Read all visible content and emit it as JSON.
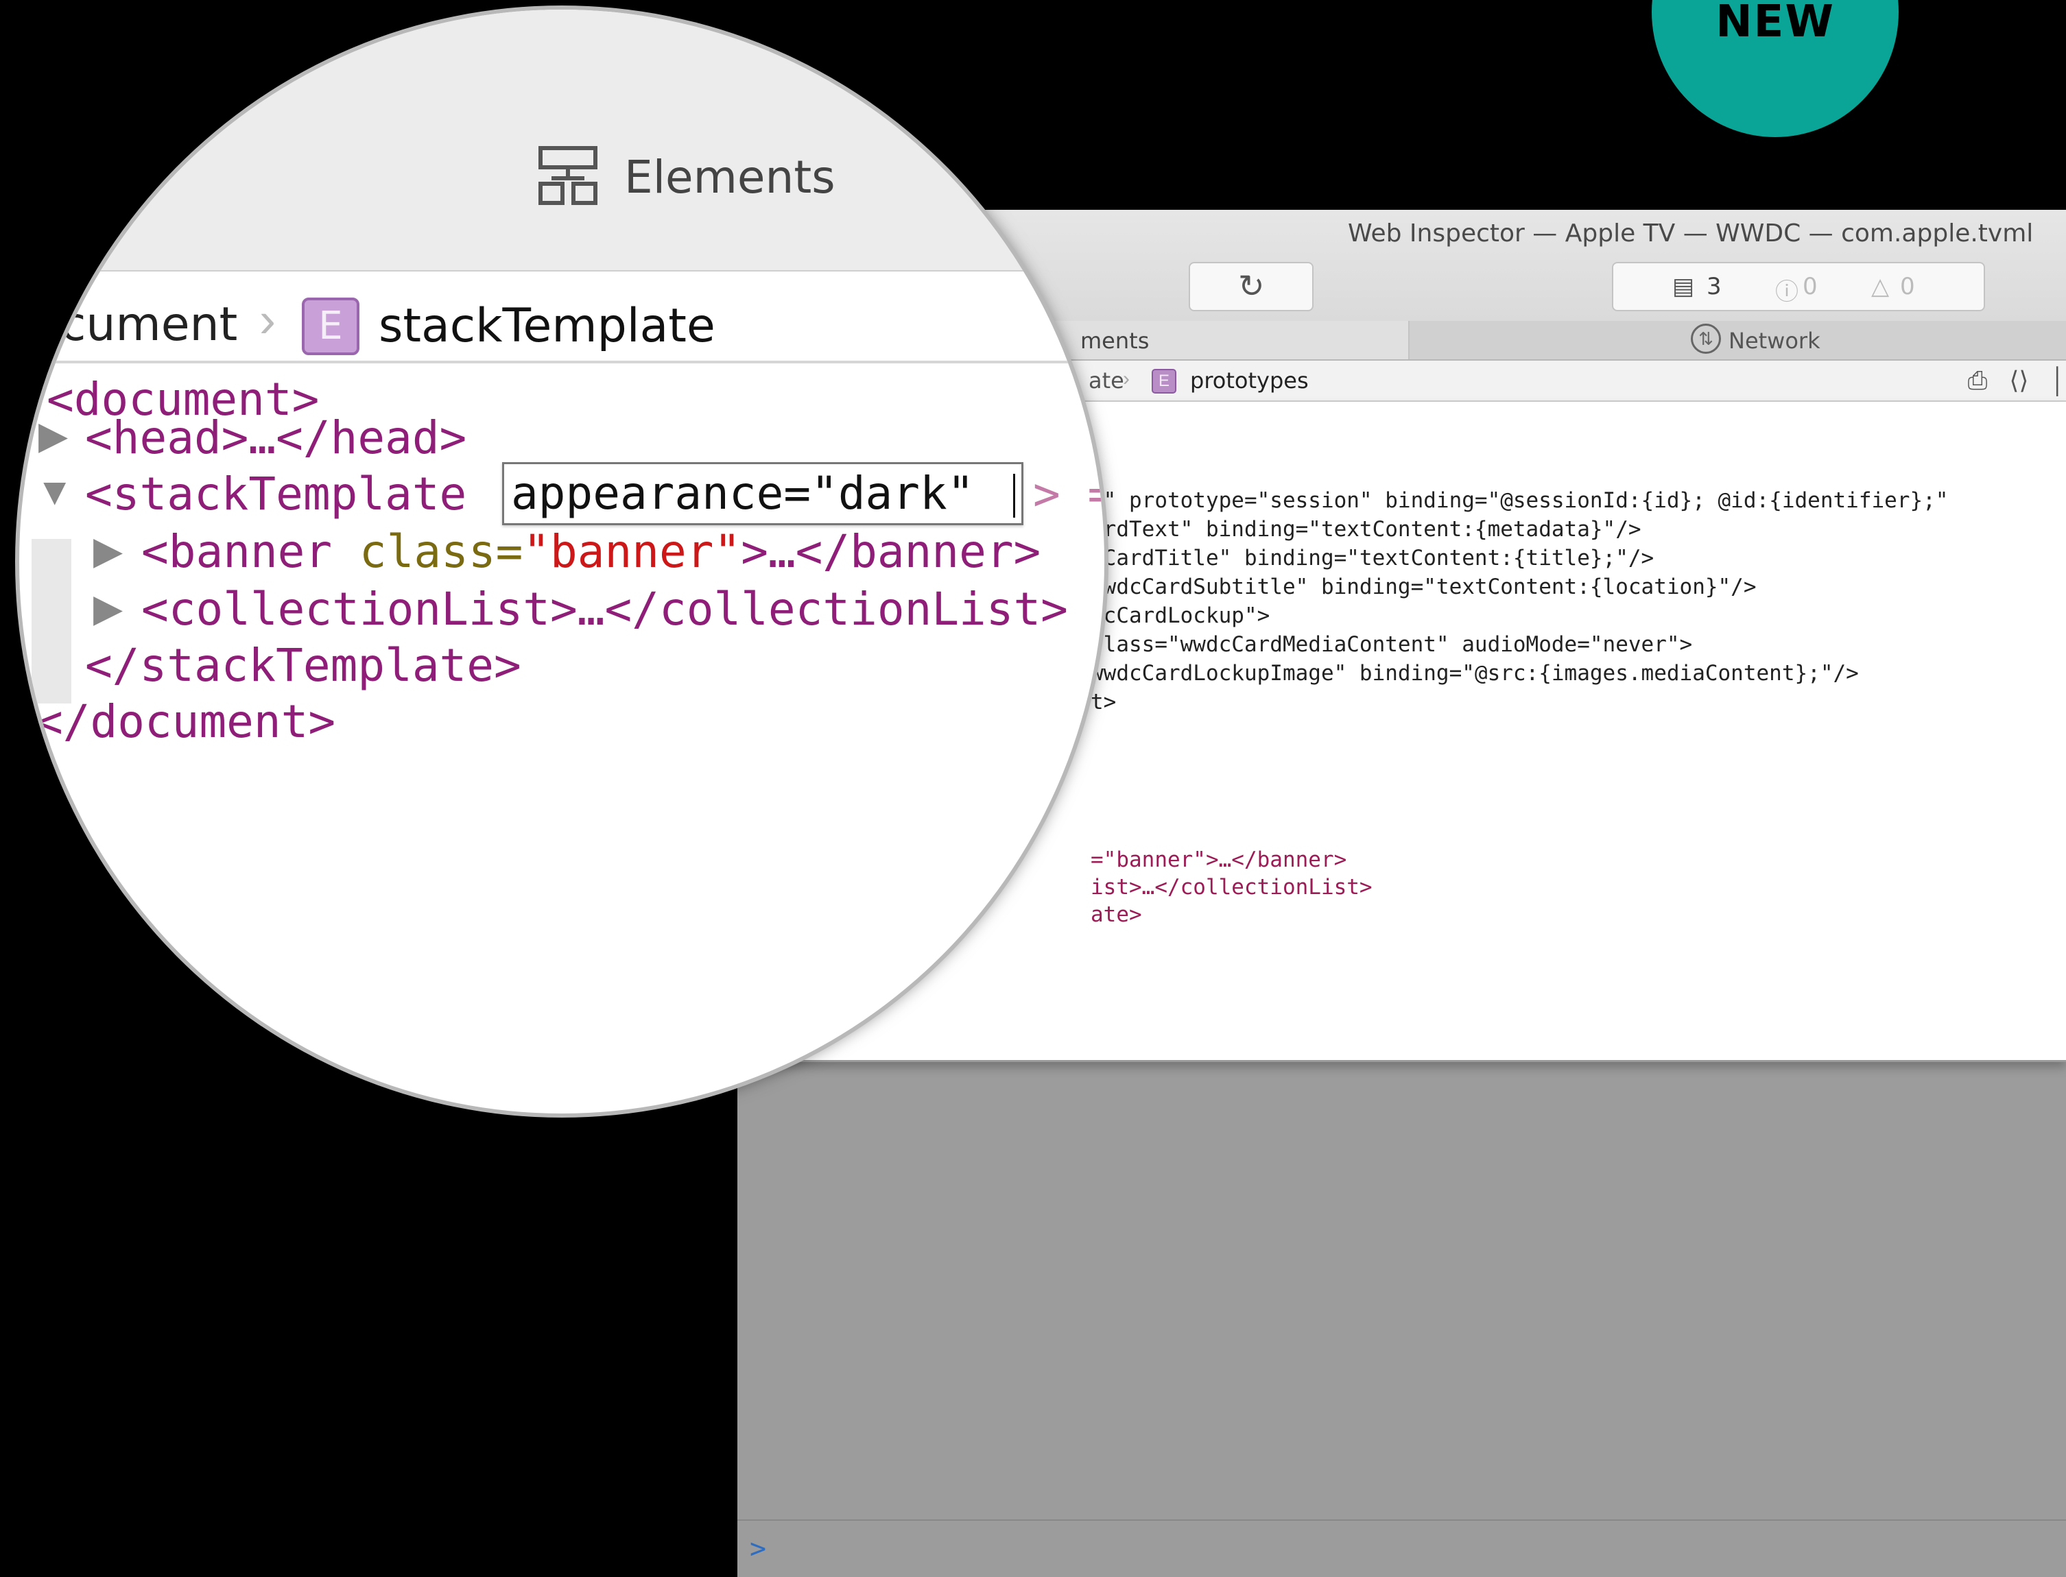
{
  "badge": {
    "label": "NEW",
    "color": "#0aa596"
  },
  "window": {
    "title": "Web Inspector — Apple TV — WWDC — com.apple.tvml",
    "toolbar": {
      "reload_icon": "reload-icon",
      "messages_count": "3",
      "errors_count": "0",
      "warnings_count": "0"
    },
    "tabs": {
      "elements_partial": "ments",
      "network": "Network"
    },
    "pathbar": {
      "truncated_item": "ate",
      "item": "prototypes"
    },
    "code_top": [
      "d\" prototype=\"session\" binding=\"@sessionId:{id}; @id:{identifier};\"",
      "ardText\" binding=\"textContent:{metadata}\"/>",
      ":CardTitle\" binding=\"textContent:{title};\"/>",
      "wwdcCardSubtitle\" binding=\"textContent:{location}\"/>",
      "dcCardLockup\">",
      ":lass=\"wwdcCardMediaContent\" audioMode=\"never\">",
      "wwdcCardLockupImage\" binding=\"@src:{images.mediaContent};\"/>",
      "t>"
    ],
    "code_bottom": [
      "=\"banner\">…</banner>",
      "ist>…</collectionList>",
      "ate>"
    ],
    "console_prompt": ">"
  },
  "magnifier": {
    "tab_label": "Elements",
    "path_document": "cument",
    "path_element_badge": "E",
    "path_element": "stackTemplate",
    "lines": {
      "document_open": "document>",
      "head": "<head>…</head>",
      "stack_open": "<stackTemplate",
      "stack_after": "> =",
      "banner_tag": "<banner ",
      "banner_attr": "class=",
      "banner_val": "\"banner\"",
      "banner_close": ">…</banner>",
      "collection": "<collectionList>…</collectionList>",
      "stack_close": "</stackTemplate>",
      "document_close": "</document>"
    },
    "editor_value": "appearance=\"dark\""
  }
}
